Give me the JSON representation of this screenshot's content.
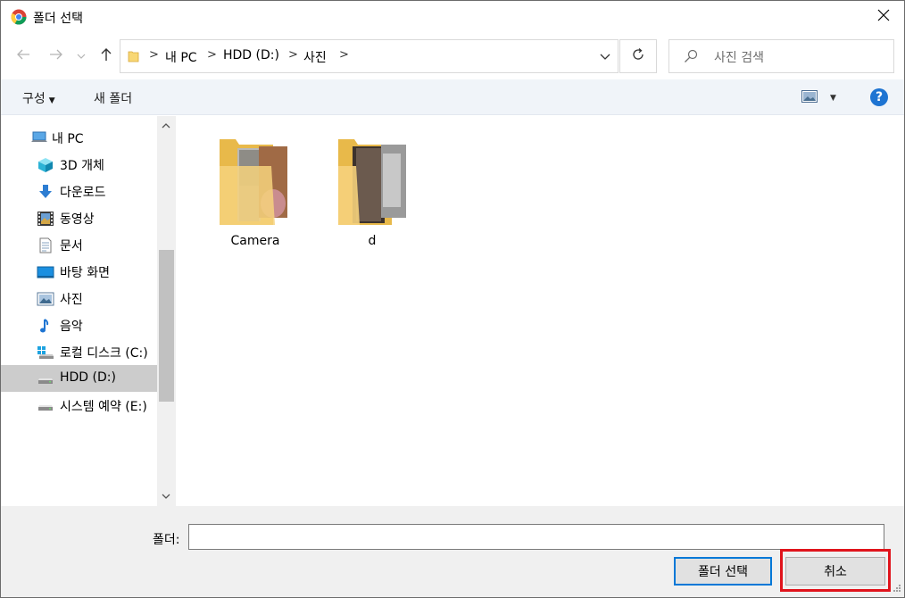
{
  "window": {
    "title": "폴더 선택",
    "app_icon": "chrome-icon",
    "close_icon": "close-icon"
  },
  "nav": {
    "back_icon": "arrow-left-icon",
    "forward_icon": "arrow-right-icon",
    "recent_icon": "chevron-down-icon",
    "up_icon": "arrow-up-icon",
    "breadcrumb": [
      "내 PC",
      "HDD (D:)",
      "사진"
    ],
    "refresh_icon": "refresh-icon",
    "search_placeholder": "사진 검색"
  },
  "toolbar": {
    "organize_label": "구성",
    "new_folder_label": "새 폴더",
    "view_icon": "view-icon",
    "help_label": "?"
  },
  "sidebar": {
    "items": [
      {
        "label": "내 PC",
        "icon": "pc-icon"
      },
      {
        "label": "3D 개체",
        "icon": "cube-icon"
      },
      {
        "label": "다운로드",
        "icon": "download-icon"
      },
      {
        "label": "동영상",
        "icon": "video-icon"
      },
      {
        "label": "문서",
        "icon": "document-icon"
      },
      {
        "label": "바탕 화면",
        "icon": "desktop-icon"
      },
      {
        "label": "사진",
        "icon": "picture-icon"
      },
      {
        "label": "음악",
        "icon": "music-icon"
      },
      {
        "label": "로컬 디스크 (C:)",
        "icon": "windows-drive-icon"
      },
      {
        "label": "HDD (D:)",
        "icon": "drive-icon"
      },
      {
        "label": "시스템 예약 (E:)",
        "icon": "drive-icon"
      }
    ],
    "selected_index": 9
  },
  "content": {
    "folders": [
      {
        "name": "Camera"
      },
      {
        "name": "d"
      }
    ]
  },
  "footer": {
    "folder_label": "폴더:",
    "folder_value": "",
    "select_button": "폴더 선택",
    "cancel_button": "취소",
    "highlight_color": "#e0141c"
  }
}
